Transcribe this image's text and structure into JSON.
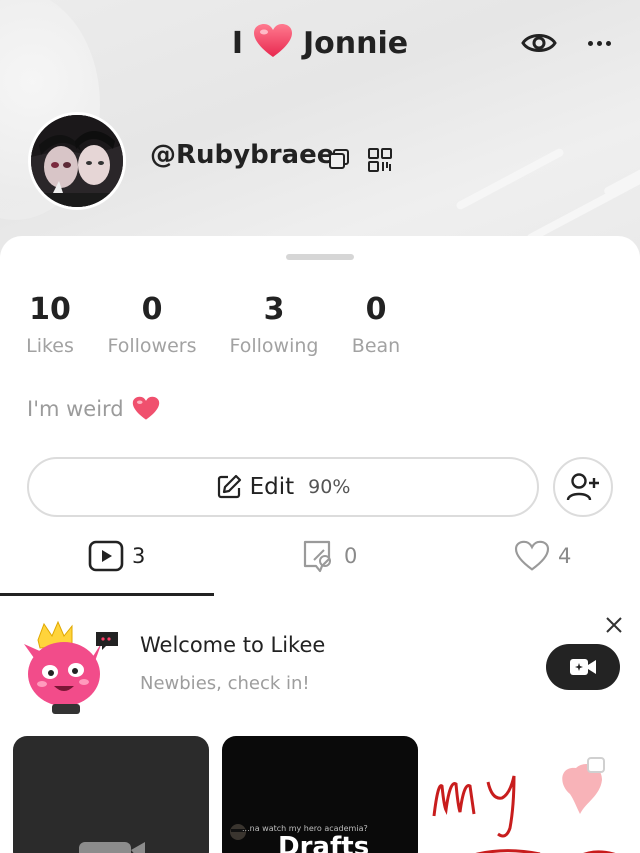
{
  "header": {
    "title_prefix": "I",
    "title_name": "Jonnie",
    "username": "@Rubybraee"
  },
  "stats": [
    {
      "value": "10",
      "label": "Likes"
    },
    {
      "value": "0",
      "label": "Followers"
    },
    {
      "value": "3",
      "label": "Following"
    },
    {
      "value": "0",
      "label": "Bean"
    }
  ],
  "bio": "I'm weird",
  "edit": {
    "label": "Edit",
    "completion": "90%"
  },
  "tabs": [
    {
      "icon": "video-icon",
      "count": "3"
    },
    {
      "icon": "tag-icon",
      "count": "0"
    },
    {
      "icon": "heart-outline-icon",
      "count": "4"
    }
  ],
  "welcome": {
    "title": "Welcome to Likee",
    "subtitle": "Newbies, check in!"
  },
  "thumbnails": {
    "drafts_label": "Drafts",
    "drafts_caption": "...na watch my hero academia?"
  },
  "colors": {
    "heart": "#f0506e",
    "dark_button": "#232323",
    "muted_text": "#9d9d9d"
  }
}
